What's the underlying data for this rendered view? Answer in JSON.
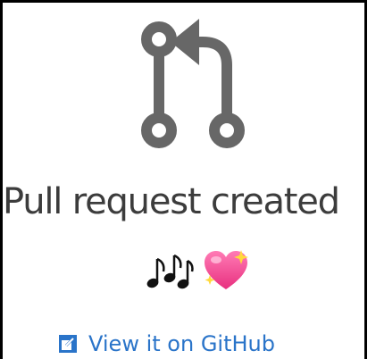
{
  "notification": {
    "title": "Pull request created",
    "link_label": "View it on GitHub"
  },
  "colors": {
    "icon_gray": "#676767",
    "title_text": "#3c3c3c",
    "link_blue": "#2a74c9",
    "heart_pink": "#f1408f"
  },
  "icons": {
    "main": "pull-request-icon",
    "emoji_1": "musical-notes-icon",
    "emoji_2": "sparkling-heart-icon",
    "link": "external-link-icon"
  }
}
